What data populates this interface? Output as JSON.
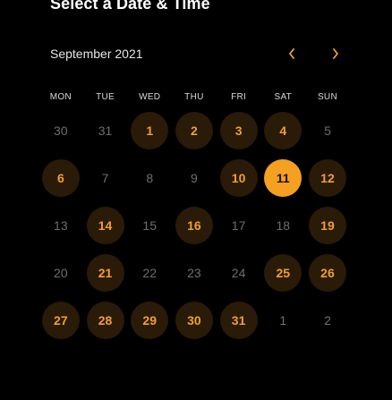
{
  "title": "Select a Date & Time",
  "month_label": "September 2021",
  "nav": {
    "prev_icon": "chevron-left-icon",
    "next_icon": "chevron-right-icon"
  },
  "weekdays": [
    "MON",
    "TUE",
    "WED",
    "THU",
    "FRI",
    "SAT",
    "SUN"
  ],
  "colors": {
    "background": "#000000",
    "available_bg": "#2a1a08",
    "available_text": "#f0a030",
    "selected_bg": "#f5a020",
    "selected_text": "#1a0f00",
    "muted_text": "#6e6e6e"
  },
  "weeks": [
    [
      {
        "label": "30",
        "state": "other"
      },
      {
        "label": "31",
        "state": "other"
      },
      {
        "label": "1",
        "state": "available"
      },
      {
        "label": "2",
        "state": "available"
      },
      {
        "label": "3",
        "state": "available"
      },
      {
        "label": "4",
        "state": "available"
      },
      {
        "label": "5",
        "state": "unavailable"
      }
    ],
    [
      {
        "label": "6",
        "state": "available"
      },
      {
        "label": "7",
        "state": "unavailable"
      },
      {
        "label": "8",
        "state": "unavailable"
      },
      {
        "label": "9",
        "state": "unavailable"
      },
      {
        "label": "10",
        "state": "available"
      },
      {
        "label": "11",
        "state": "selected"
      },
      {
        "label": "12",
        "state": "available"
      }
    ],
    [
      {
        "label": "13",
        "state": "unavailable"
      },
      {
        "label": "14",
        "state": "available"
      },
      {
        "label": "15",
        "state": "unavailable"
      },
      {
        "label": "16",
        "state": "available"
      },
      {
        "label": "17",
        "state": "unavailable"
      },
      {
        "label": "18",
        "state": "unavailable"
      },
      {
        "label": "19",
        "state": "available"
      }
    ],
    [
      {
        "label": "20",
        "state": "unavailable"
      },
      {
        "label": "21",
        "state": "available"
      },
      {
        "label": "22",
        "state": "unavailable"
      },
      {
        "label": "23",
        "state": "unavailable"
      },
      {
        "label": "24",
        "state": "unavailable"
      },
      {
        "label": "25",
        "state": "available"
      },
      {
        "label": "26",
        "state": "available"
      }
    ],
    [
      {
        "label": "27",
        "state": "available"
      },
      {
        "label": "28",
        "state": "available"
      },
      {
        "label": "29",
        "state": "available"
      },
      {
        "label": "30",
        "state": "available"
      },
      {
        "label": "31",
        "state": "available"
      },
      {
        "label": "1",
        "state": "other"
      },
      {
        "label": "2",
        "state": "other"
      }
    ]
  ]
}
